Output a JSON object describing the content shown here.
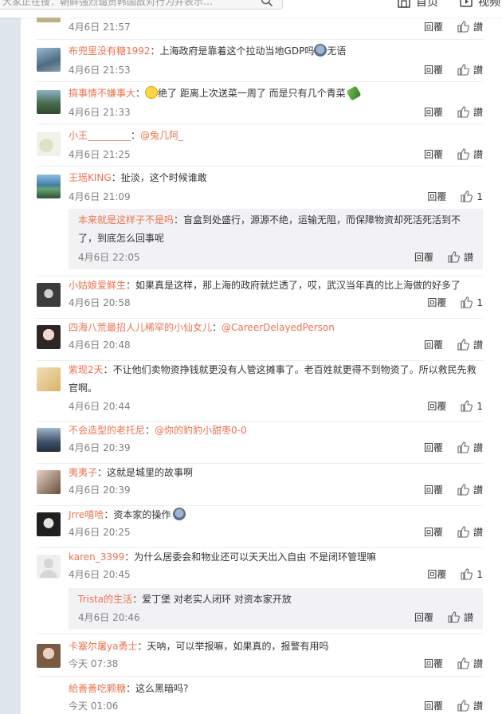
{
  "topbar": {
    "search_placeholder": "大家正在搜：朝鲜强烈谴责韩国敌对行为并表示…",
    "home_label": "首页",
    "video_label": "视频"
  },
  "colors": {
    "name": "#eb7350",
    "meta": "#808080",
    "panel": "#ffffff",
    "page_bg": "#dfe6ee"
  },
  "action_labels": {
    "reply": "回覆",
    "like": "讃"
  },
  "comments": [
    {
      "user": "",
      "text": "",
      "time": "4月6日 21:57",
      "likes": ""
    },
    {
      "user": "布兜里没有糖1992",
      "text": "：上海政府是靠着这个拉动当地GDP吗",
      "text2": "无语",
      "time": "4月6日 21:53",
      "likes": ""
    },
    {
      "user": "搞事情不嫌事大",
      "text": "：",
      "text2": "绝了 距离上次送菜一周了 而是只有几个青菜",
      "time": "4月6日 21:33",
      "likes": ""
    },
    {
      "user": "小王_________",
      "text": "：",
      "mention": "@兔几阿_",
      "time": "4月6日 21:25",
      "likes": ""
    },
    {
      "user": "王瑶KING",
      "text": "：扯淡，这个时候谁敢",
      "time": "4月6日 21:09",
      "likes": "1"
    },
    {
      "user": "小姑娘爱鲜生",
      "text": "：如果真是这样，那上海的政府就烂透了，哎，武汉当年真的比上海做的好多了",
      "time": "4月6日 20:58",
      "likes": "1"
    },
    {
      "user": "四海八荒最招人儿稀罕的小仙女儿",
      "text": "：",
      "mention": "@CareerDelayedPerson",
      "time": "4月6日 20:48",
      "likes": ""
    },
    {
      "user": "紫现2天",
      "text": "：不让他们卖物资挣钱就更没有人管这摊事了。老百姓就更得不到物资了。所以救民先救官啊。",
      "time": "4月6日 20:44",
      "likes": "1"
    },
    {
      "user": "不会造型的老托尼",
      "text": "：",
      "mention": "@你的豹豹小甜枣0-0",
      "time": "4月6日 20:39",
      "likes": ""
    },
    {
      "user": "夷夷子",
      "text": "：这就是城里的故事啊",
      "time": "4月6日 20:39",
      "likes": ""
    },
    {
      "user": "Jrre嘻哈",
      "text": "：资本家的操作",
      "time": "4月6日 20:25",
      "likes": ""
    },
    {
      "user": "karen_3399",
      "text": "：为什么居委会和物业还可以天天出入自由 不是闭环管理嘛",
      "time": "4月6日 20:45",
      "likes": "1"
    },
    {
      "user": "卡塞尔屠ya勇士",
      "text": "：天呐，可以举报嘛，如果真的，报警有用吗",
      "time": "今天 07:38",
      "likes": ""
    },
    {
      "user": "給善善吃颗糖",
      "text": "：这么黑暗吗?",
      "time": "今天 01:06",
      "likes": ""
    }
  ],
  "subreplies": [
    {
      "user": "本来就是这样子不是吗",
      "text": "：盲盒到处盛行，源源不绝，运输无阻，而保障物资却死活死活到不了，到底怎么回事呢",
      "time": "4月6日 22:05"
    },
    {
      "user": "Trista的生活",
      "text": "：爱丁堡 对老实人闭环 对资本家开放",
      "time": "4月6日 20:46"
    }
  ]
}
